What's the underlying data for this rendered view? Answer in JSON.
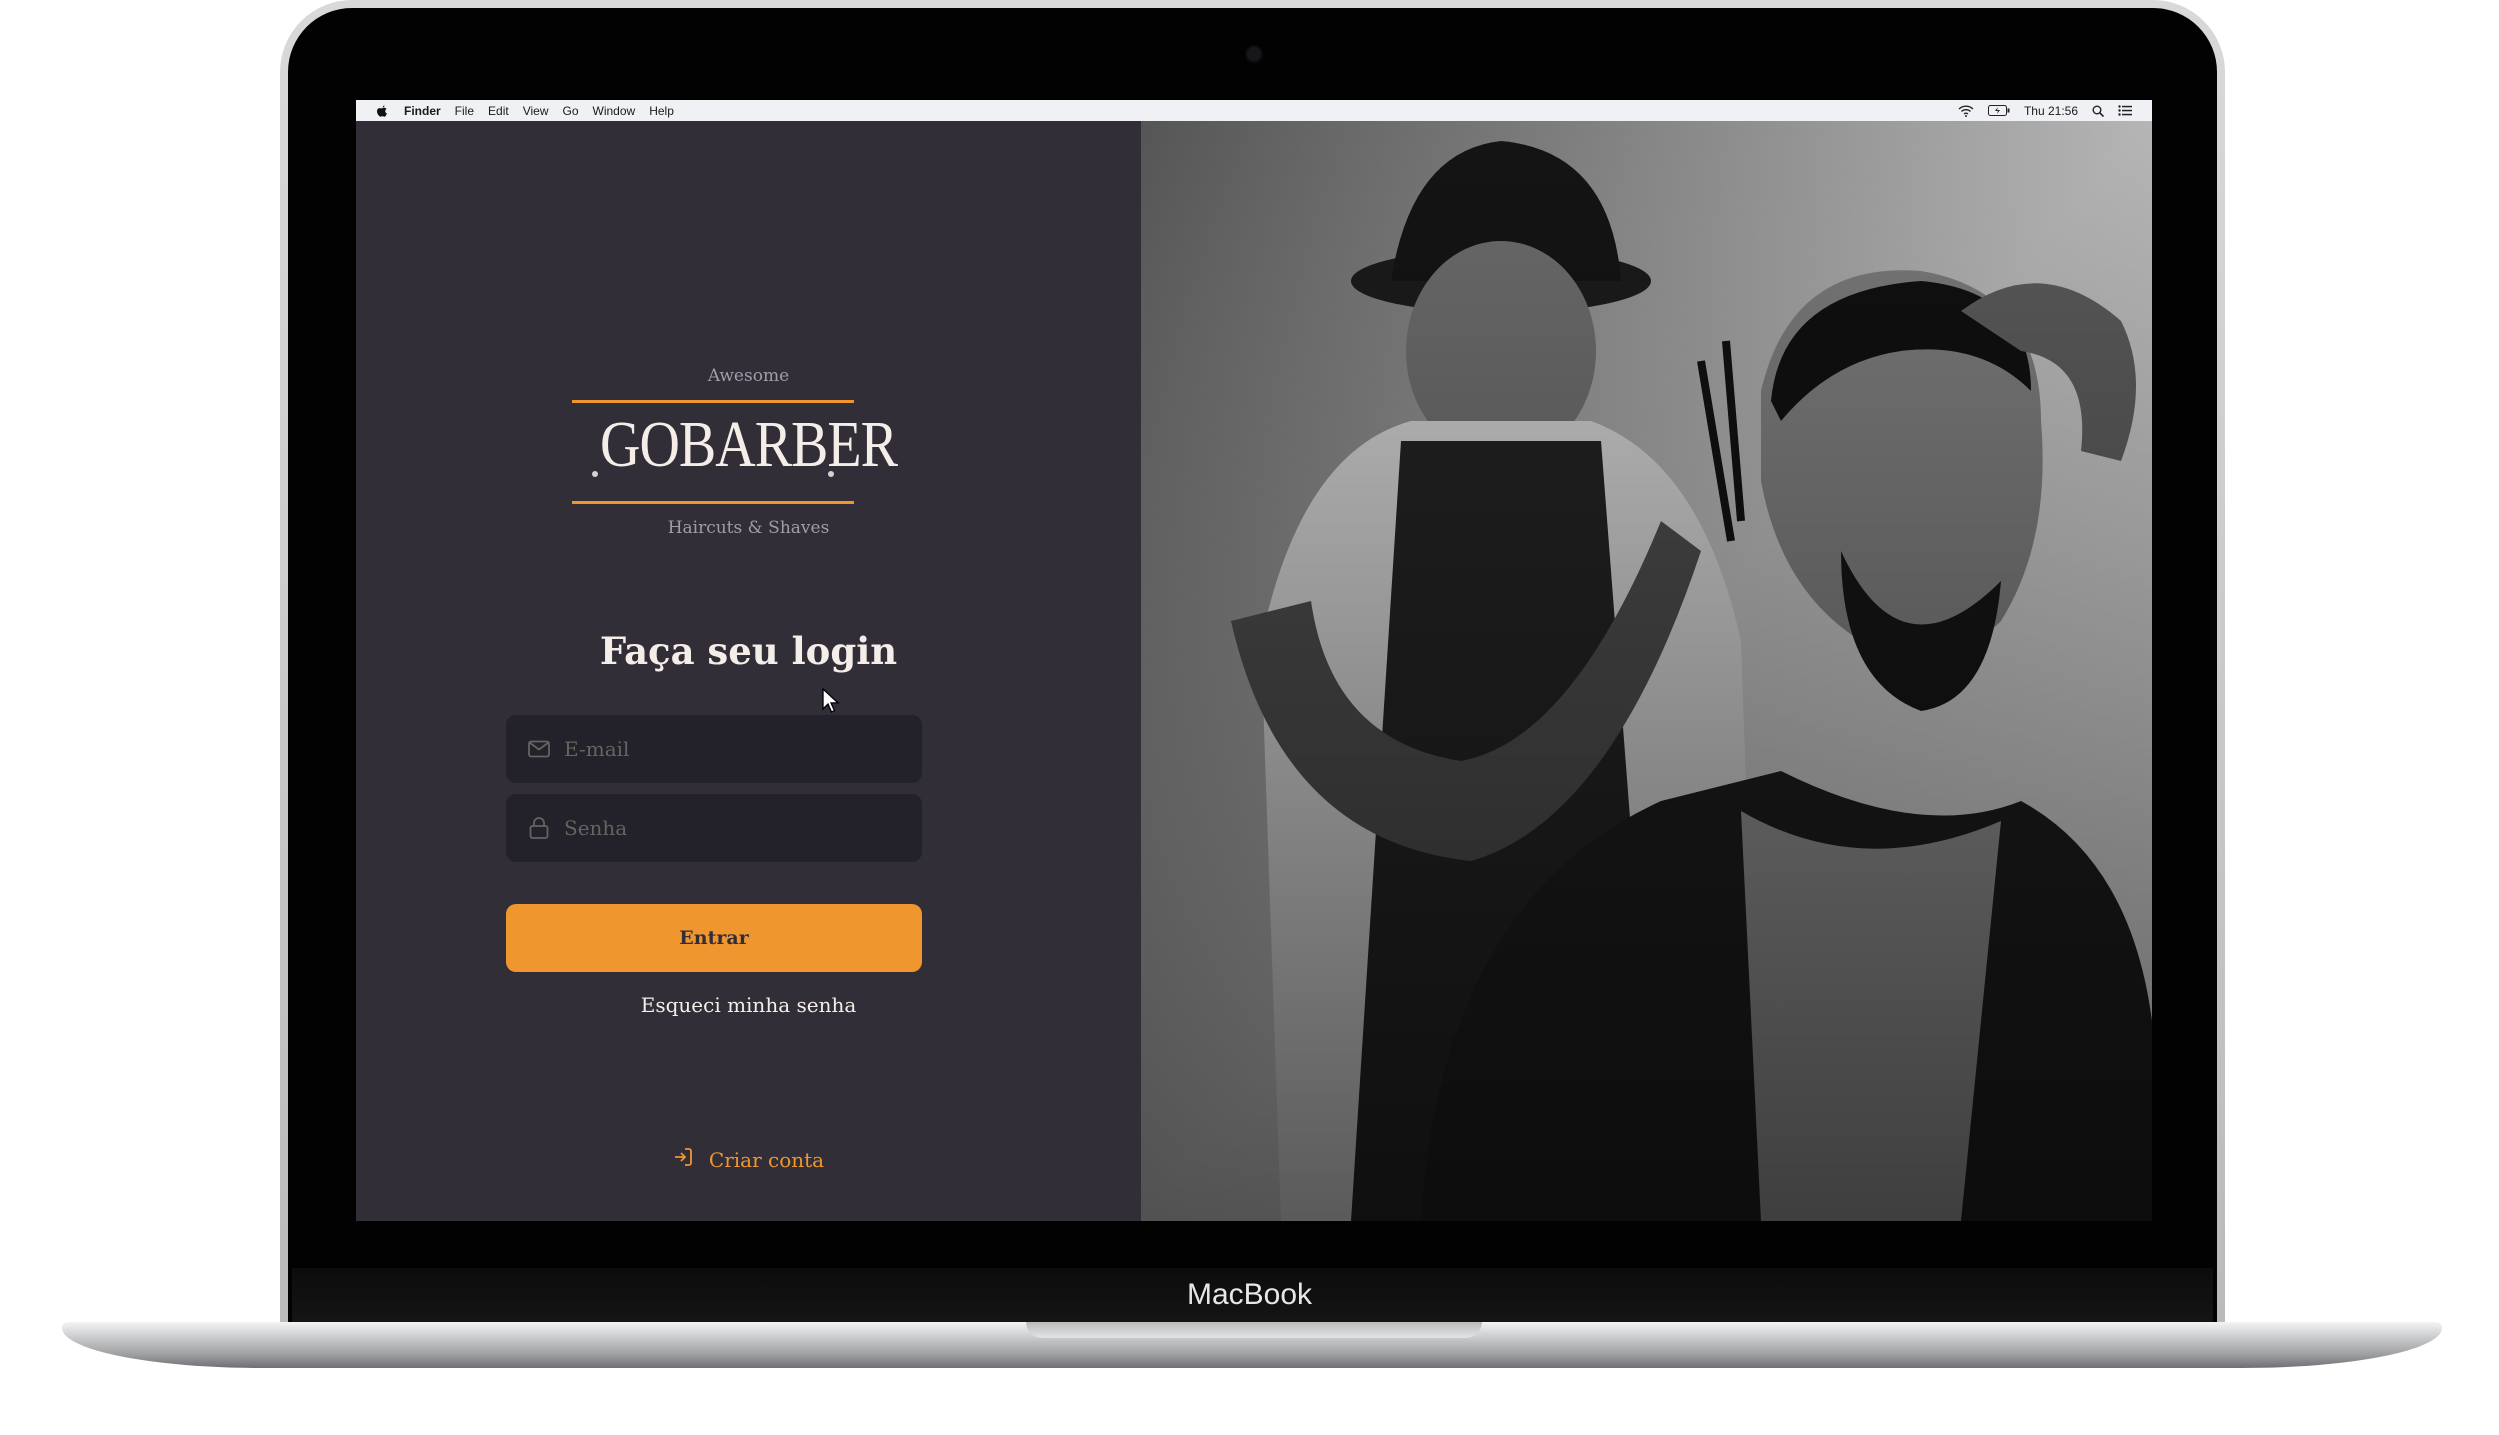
{
  "device": {
    "brand_label": "MacBook"
  },
  "menubar": {
    "app": "Finder",
    "items": [
      "File",
      "Edit",
      "View",
      "Go",
      "Window",
      "Help"
    ],
    "clock": "Thu 21:56"
  },
  "logo": {
    "tagline_top": "Awesome",
    "name": "GOBARBER",
    "tagline_bottom": "Haircuts & Shaves"
  },
  "login": {
    "title": "Faça seu login",
    "email": {
      "placeholder": "E-mail",
      "value": ""
    },
    "password": {
      "placeholder": "Senha",
      "value": ""
    },
    "submit_label": "Entrar",
    "forgot_label": "Esqueci minha senha",
    "create_label": "Criar conta"
  },
  "colors": {
    "accent": "#f0962f",
    "background": "#312e38",
    "input_bg": "#232129",
    "text": "#f4ede8"
  },
  "hero_image": {
    "description_icon": "barber-photo"
  }
}
